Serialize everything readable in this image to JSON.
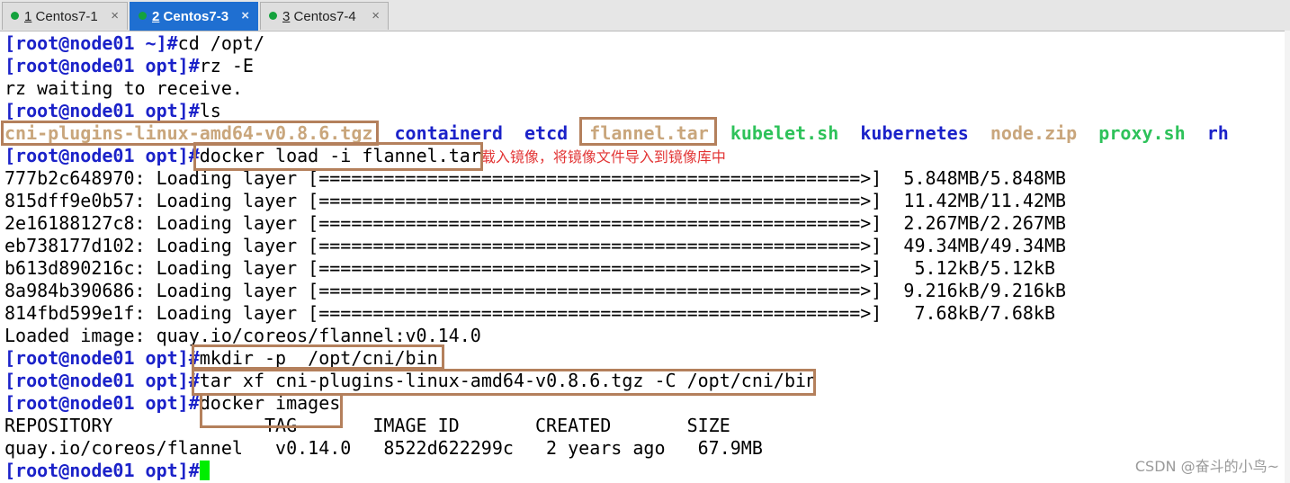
{
  "tabs": [
    {
      "num": "1",
      "name": "Centos7-1",
      "active": false,
      "dot": "#14a23d"
    },
    {
      "num": "2",
      "name": "Centos7-3",
      "active": true,
      "dot": "#14a23d"
    },
    {
      "num": "3",
      "name": "Centos7-4",
      "active": false,
      "dot": "#14a23d"
    }
  ],
  "tab_close_glyph": "×",
  "prompt_home": "[root@node01 ~]#",
  "prompt_opt": "[root@node01 opt]#",
  "lines": {
    "l1_cmd": "cd /opt/",
    "l2_cmd": "rz -E",
    "l3_text": "rz waiting to receive.",
    "l4_cmd": "ls",
    "ls_files": {
      "cni": "cni-plugins-linux-amd64-v0.8.6.tgz",
      "containerd": "containerd",
      "etcd": "etcd",
      "flannel": "flannel.tar",
      "kubelet": "kubelet.sh",
      "kubernetes": "kubernetes",
      "nodezip": "node.zip",
      "proxy": "proxy.sh",
      "rh": "rh"
    },
    "load_cmd": "docker load -i flannel.tar",
    "load_note": "载入镜像，将镜像文件导入到镜像库中",
    "layers": [
      "777b2c648970: Loading layer [==================================================>]  5.848MB/5.848MB",
      "815dff9e0b57: Loading layer [==================================================>]  11.42MB/11.42MB",
      "2e16188127c8: Loading layer [==================================================>]  2.267MB/2.267MB",
      "eb738177d102: Loading layer [==================================================>]  49.34MB/49.34MB",
      "b613d890216c: Loading layer [==================================================>]   5.12kB/5.12kB",
      "8a984b390686: Loading layer [==================================================>]  9.216kB/9.216kB",
      "814fbd599e1f: Loading layer [==================================================>]   7.68kB/7.68kB"
    ],
    "loaded": "Loaded image: quay.io/coreos/flannel:v0.14.0",
    "mkdir_cmd": "mkdir -p  /opt/cni/bin",
    "tar_cmd": "tar xf cni-plugins-linux-amd64-v0.8.6.tgz -C /opt/cni/bin",
    "images_cmd": "docker images",
    "images_header": "REPOSITORY              TAG       IMAGE ID       CREATED       SIZE",
    "images_row": "quay.io/coreos/flannel   v0.14.0   8522d622299c   2 years ago   67.9MB"
  },
  "watermark": "CSDN @奋斗的小鸟~",
  "colors": {
    "prompt": "#1b22c9",
    "dir": "#1b22c9",
    "archive": "#c9a67c",
    "executable": "#2ec25a",
    "annotation_box": "#b4805c",
    "note": "#e23535",
    "cursor": "#00ee00",
    "active_tab": "#1f6fd1"
  }
}
